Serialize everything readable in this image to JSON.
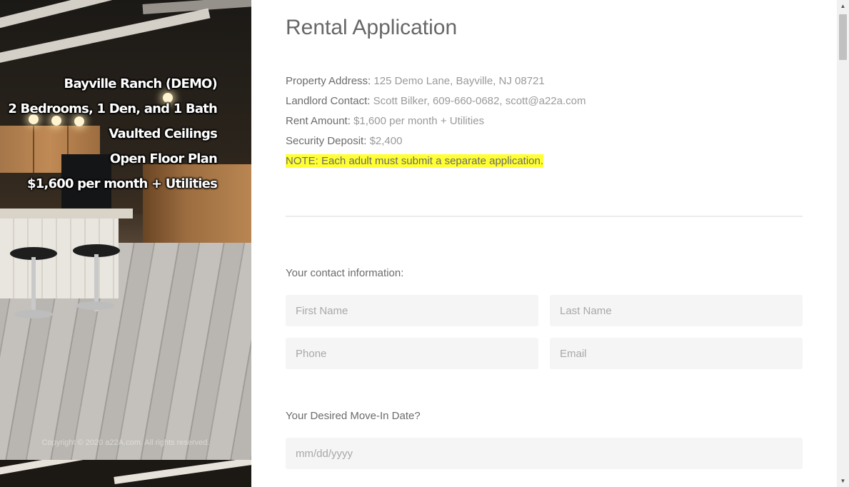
{
  "hero": {
    "lines": [
      "Bayville Ranch (DEMO)",
      "2 Bedrooms, 1 Den, and 1 Bath",
      "Vaulted Ceilings",
      "Open Floor Plan",
      "$1,600 per month + Utilities"
    ],
    "copyright": "Copyright © 2020 a22A.com. All rights reserved."
  },
  "page": {
    "title": "Rental Application"
  },
  "info": {
    "property_label": "Property Address:",
    "property_value": "125 Demo Lane, Bayville, NJ 08721",
    "landlord_label": "Landlord Contact:",
    "landlord_value": "Scott Bilker, 609-660-0682, scott@a22a.com",
    "rent_label": "Rent Amount:",
    "rent_value": "$1,600 per month + Utilities",
    "deposit_label": "Security Deposit:",
    "deposit_value": "$2,400",
    "note": "NOTE: Each adult must submit a separate application."
  },
  "form": {
    "contact_label": "Your contact information:",
    "first_name_placeholder": "First Name",
    "last_name_placeholder": "Last Name",
    "phone_placeholder": "Phone",
    "email_placeholder": "Email",
    "move_in_label": "Your Desired Move-In Date?",
    "move_in_placeholder": "mm/dd/yyyy"
  },
  "scrollbar": {
    "up_arrow": "▲",
    "down_arrow": "▼"
  },
  "colors": {
    "note_highlight": "#ffff33",
    "field_background": "#f5f5f5",
    "title_text": "#676767"
  }
}
